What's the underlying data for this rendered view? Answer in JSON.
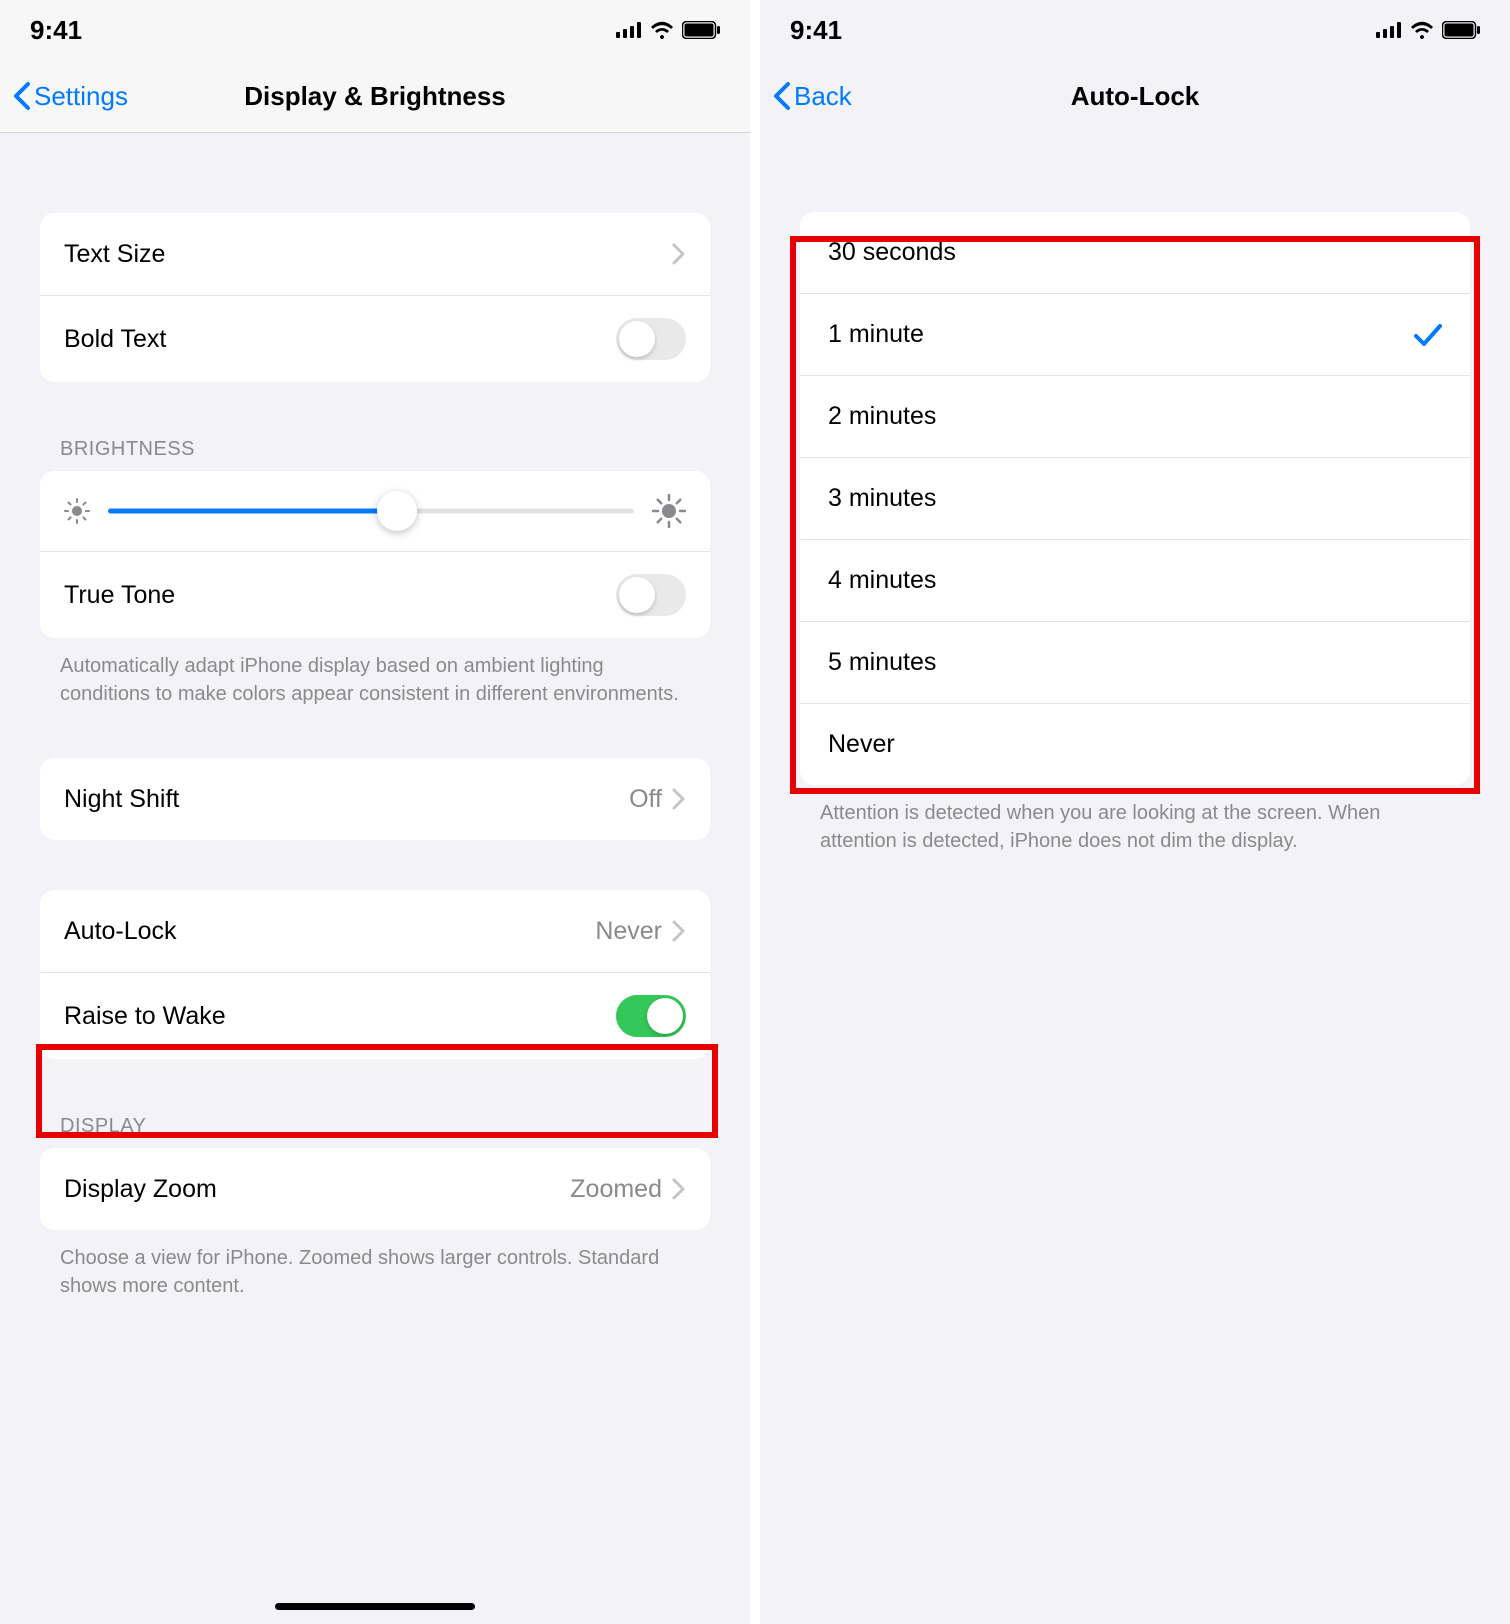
{
  "status": {
    "time": "9:41"
  },
  "left": {
    "nav": {
      "back": "Settings",
      "title": "Display & Brightness"
    },
    "text_size": {
      "label": "Text Size"
    },
    "bold_text": {
      "label": "Bold Text",
      "on": false
    },
    "brightness_header": "BRIGHTNESS",
    "brightness_percent": 55,
    "true_tone": {
      "label": "True Tone",
      "on": false
    },
    "true_tone_footer": "Automatically adapt iPhone display based on ambient lighting conditions to make colors appear consistent in different environments.",
    "night_shift": {
      "label": "Night Shift",
      "value": "Off"
    },
    "auto_lock": {
      "label": "Auto-Lock",
      "value": "Never"
    },
    "raise_to_wake": {
      "label": "Raise to Wake",
      "on": true
    },
    "display_header": "DISPLAY",
    "display_zoom": {
      "label": "Display Zoom",
      "value": "Zoomed"
    },
    "display_footer": "Choose a view for iPhone. Zoomed shows larger controls. Standard shows more content."
  },
  "right": {
    "nav": {
      "back": "Back",
      "title": "Auto-Lock"
    },
    "options": [
      {
        "label": "30 seconds",
        "selected": false
      },
      {
        "label": "1 minute",
        "selected": true
      },
      {
        "label": "2 minutes",
        "selected": false
      },
      {
        "label": "3 minutes",
        "selected": false
      },
      {
        "label": "4 minutes",
        "selected": false
      },
      {
        "label": "5 minutes",
        "selected": false
      },
      {
        "label": "Never",
        "selected": false
      }
    ],
    "footer": "Attention is detected when you are looking at the screen. When attention is detected, iPhone does not dim the display."
  }
}
